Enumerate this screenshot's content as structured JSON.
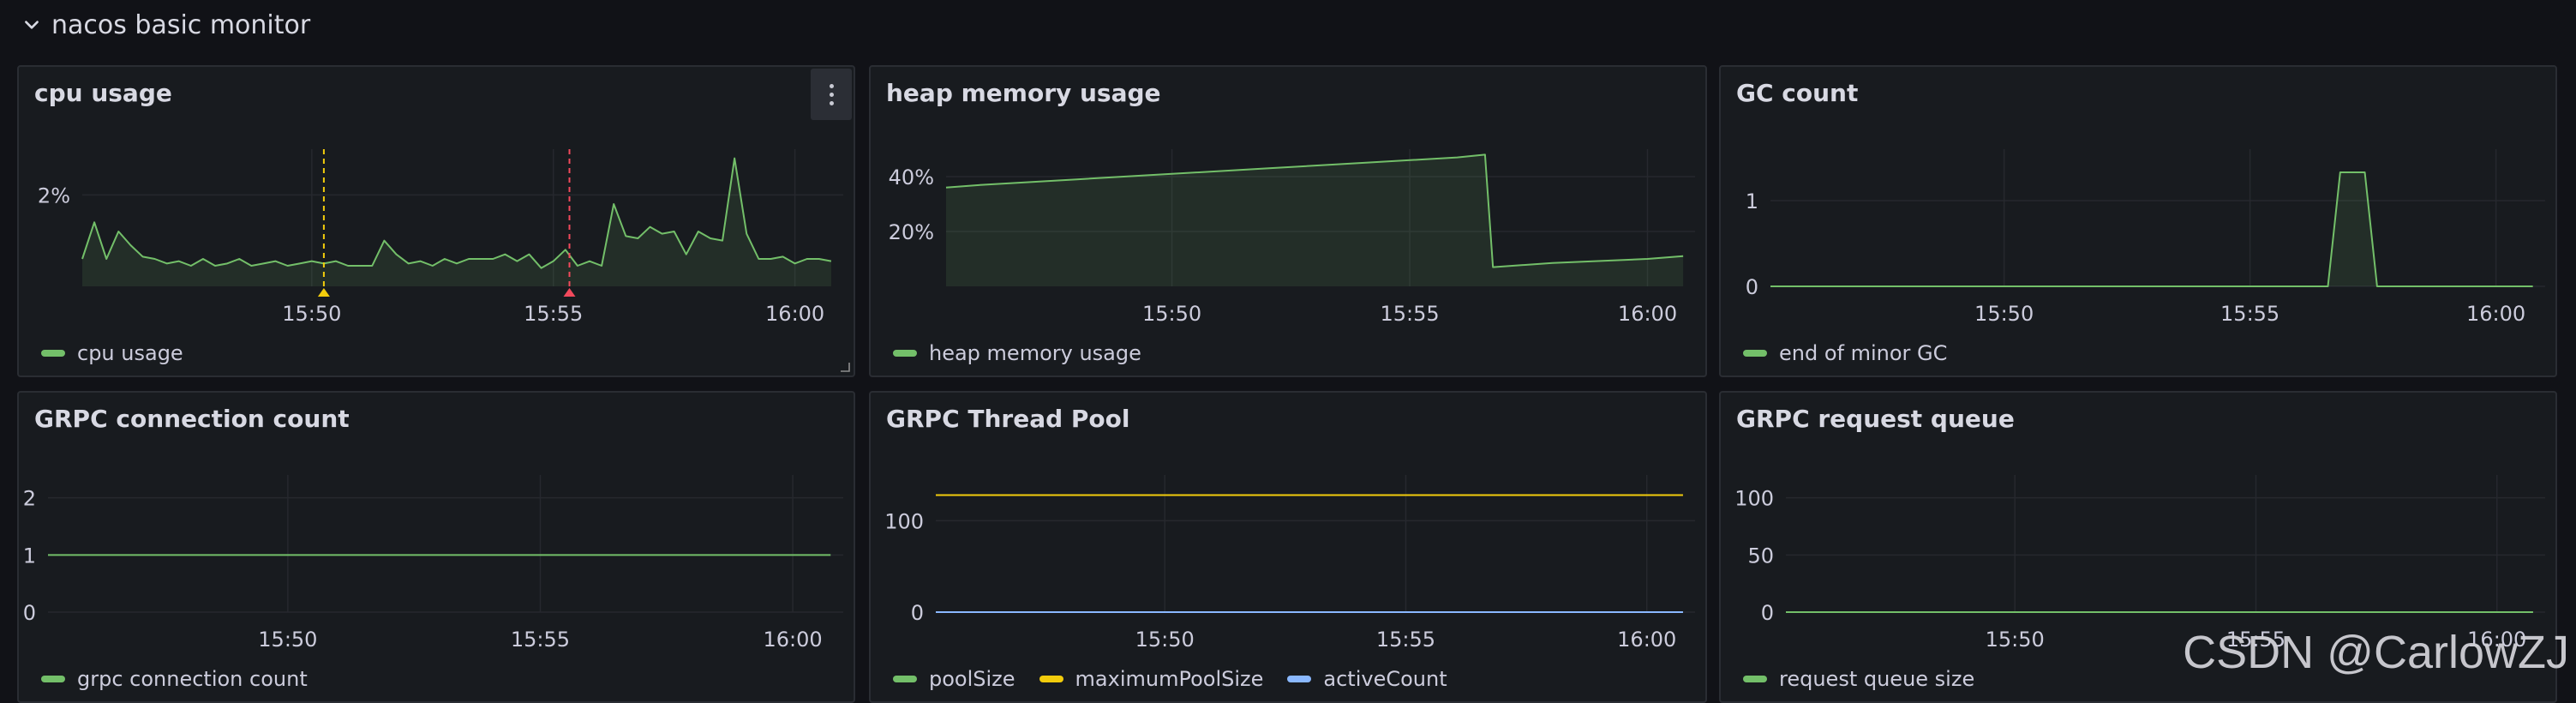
{
  "dashboard": {
    "row_title": "nacos basic monitor",
    "panels": [
      {
        "title": "cpu usage",
        "legend": [
          "cpu usage"
        ],
        "colors": [
          "#73bf69"
        ],
        "yticks": [
          "2%"
        ],
        "xticks": [
          "15:50",
          "15:55",
          "16:00"
        ],
        "annotations": [
          {
            "time": "15:50:15",
            "color": "#f2cc0c"
          },
          {
            "time": "15:55:20",
            "color": "#f2495c"
          }
        ]
      },
      {
        "title": "heap memory usage",
        "legend": [
          "heap memory usage"
        ],
        "colors": [
          "#73bf69"
        ],
        "yticks": [
          "40%",
          "20%"
        ],
        "xticks": [
          "15:50",
          "15:55",
          "16:00"
        ]
      },
      {
        "title": "GC count",
        "legend": [
          "end of minor GC"
        ],
        "colors": [
          "#73bf69"
        ],
        "yticks": [
          "1",
          "0"
        ],
        "xticks": [
          "15:50",
          "15:55",
          "16:00"
        ]
      },
      {
        "title": "GRPC connection count",
        "legend": [
          "grpc connection count"
        ],
        "colors": [
          "#73bf69"
        ],
        "yticks": [
          "2",
          "1",
          "0"
        ],
        "xticks": [
          "15:50",
          "15:55",
          "16:00"
        ]
      },
      {
        "title": "GRPC Thread Pool",
        "legend": [
          "poolSize",
          "maximumPoolSize",
          "activeCount"
        ],
        "colors": [
          "#73bf69",
          "#f2cc0c",
          "#8ab8ff"
        ],
        "yticks": [
          "100",
          "0"
        ],
        "xticks": [
          "15:50",
          "15:55",
          "16:00"
        ]
      },
      {
        "title": "GRPC request queue",
        "legend": [
          "request queue size"
        ],
        "colors": [
          "#73bf69"
        ],
        "yticks": [
          "100",
          "50",
          "0"
        ],
        "xticks": [
          "15:50",
          "15:55",
          "16:00"
        ]
      }
    ]
  },
  "watermark": "CSDN @CarlowZJ",
  "chart_data": [
    {
      "type": "area",
      "title": "cpu usage",
      "x_range": [
        "15:45:15",
        "16:01:00"
      ],
      "ylim": [
        0,
        3
      ],
      "series": [
        {
          "name": "cpu usage",
          "color": "#73bf69",
          "x": [
            "15:45:15",
            "15:45:30",
            "15:45:45",
            "15:46:00",
            "15:46:15",
            "15:46:30",
            "15:46:45",
            "15:47:00",
            "15:47:15",
            "15:47:30",
            "15:47:45",
            "15:48:00",
            "15:48:15",
            "15:48:30",
            "15:48:45",
            "15:49:00",
            "15:49:15",
            "15:49:30",
            "15:49:45",
            "15:50:00",
            "15:50:15",
            "15:50:30",
            "15:50:45",
            "15:51:00",
            "15:51:15",
            "15:51:30",
            "15:51:45",
            "15:52:00",
            "15:52:15",
            "15:52:30",
            "15:52:45",
            "15:53:00",
            "15:53:15",
            "15:53:30",
            "15:53:45",
            "15:54:00",
            "15:54:15",
            "15:54:30",
            "15:54:45",
            "15:55:00",
            "15:55:15",
            "15:55:30",
            "15:55:45",
            "15:56:00",
            "15:56:15",
            "15:56:30",
            "15:56:45",
            "15:57:00",
            "15:57:15",
            "15:57:30",
            "15:57:45",
            "15:58:00",
            "15:58:15",
            "15:58:30",
            "15:58:45",
            "15:59:00",
            "15:59:15",
            "15:59:30",
            "15:59:45",
            "16:00:00",
            "16:00:15",
            "16:00:30",
            "16:00:45"
          ],
          "values": [
            0.6,
            1.4,
            0.6,
            1.2,
            0.9,
            0.65,
            0.6,
            0.5,
            0.55,
            0.45,
            0.6,
            0.45,
            0.5,
            0.6,
            0.45,
            0.5,
            0.55,
            0.45,
            0.5,
            0.55,
            0.5,
            0.55,
            0.45,
            0.45,
            0.45,
            1.0,
            0.7,
            0.5,
            0.55,
            0.45,
            0.6,
            0.5,
            0.6,
            0.6,
            0.6,
            0.7,
            0.55,
            0.7,
            0.4,
            0.55,
            0.8,
            0.45,
            0.55,
            0.45,
            1.8,
            1.1,
            1.05,
            1.3,
            1.15,
            1.2,
            0.7,
            1.2,
            1.05,
            1.0,
            2.8,
            1.15,
            0.6,
            0.6,
            0.65,
            0.5,
            0.6,
            0.6,
            0.55
          ]
        }
      ]
    },
    {
      "type": "area",
      "title": "heap memory usage",
      "x_range": [
        "15:45:15",
        "16:01:00"
      ],
      "ylim": [
        0,
        50
      ],
      "series": [
        {
          "name": "heap memory usage",
          "color": "#73bf69",
          "x": [
            "15:45:15",
            "15:46:00",
            "15:48:00",
            "15:50:00",
            "15:52:00",
            "15:54:00",
            "15:56:00",
            "15:56:35",
            "15:56:45",
            "15:58:00",
            "16:00:00",
            "16:00:45"
          ],
          "values": [
            36,
            37,
            39,
            41,
            43,
            45,
            47,
            48,
            7,
            8.5,
            10,
            11
          ]
        }
      ]
    },
    {
      "type": "area",
      "title": "GC count",
      "x_range": [
        "15:45:15",
        "16:01:00"
      ],
      "ylim": [
        0,
        1.6
      ],
      "series": [
        {
          "name": "end of minor GC",
          "color": "#73bf69",
          "x": [
            "15:45:15",
            "15:56:35",
            "15:56:50",
            "15:57:20",
            "15:57:35",
            "16:00:45"
          ],
          "values": [
            0,
            0,
            1.33,
            1.33,
            0,
            0
          ]
        }
      ]
    },
    {
      "type": "line",
      "title": "GRPC connection count",
      "x_range": [
        "15:45:15",
        "16:01:00"
      ],
      "ylim": [
        0,
        2.4
      ],
      "series": [
        {
          "name": "grpc connection count",
          "color": "#73bf69",
          "x": [
            "15:45:15",
            "16:00:45"
          ],
          "values": [
            1,
            1
          ]
        }
      ]
    },
    {
      "type": "line",
      "title": "GRPC Thread Pool",
      "x_range": [
        "15:45:15",
        "16:01:00"
      ],
      "ylim": [
        0,
        150
      ],
      "series": [
        {
          "name": "poolSize",
          "color": "#73bf69",
          "x": [
            "15:45:15",
            "16:00:45"
          ],
          "values": [
            0,
            0
          ]
        },
        {
          "name": "maximumPoolSize",
          "color": "#f2cc0c",
          "x": [
            "15:45:15",
            "16:00:45"
          ],
          "values": [
            128,
            128
          ]
        },
        {
          "name": "activeCount",
          "color": "#8ab8ff",
          "x": [
            "15:45:15",
            "16:00:45"
          ],
          "values": [
            0,
            0
          ]
        }
      ]
    },
    {
      "type": "line",
      "title": "GRPC request queue",
      "x_range": [
        "15:45:15",
        "16:01:00"
      ],
      "ylim": [
        0,
        120
      ],
      "series": [
        {
          "name": "request queue size",
          "color": "#73bf69",
          "x": [
            "15:45:15",
            "16:00:45"
          ],
          "values": [
            0,
            0
          ]
        }
      ]
    }
  ]
}
